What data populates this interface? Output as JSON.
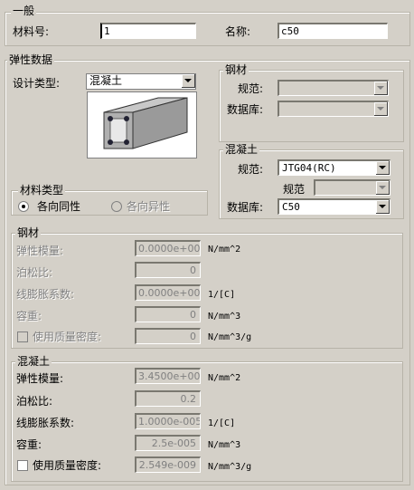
{
  "general": {
    "title": "一般",
    "material_no_label": "材料号:",
    "material_no_value": "1",
    "name_label": "名称:",
    "name_value": "c50"
  },
  "elastic": {
    "title": "弹性数据",
    "design_type_label": "设计类型:",
    "design_type_value": "混凝土",
    "material_type": {
      "title": "材料类型",
      "isotropic_label": "各向同性",
      "anisotropic_label": "各向异性",
      "selected": "isotropic"
    },
    "steel_box": {
      "title": "钢材",
      "spec_label": "规范:",
      "db_label": "数据库:",
      "spec_value": "",
      "db_value": ""
    },
    "concrete_box": {
      "title": "混凝土",
      "spec_label": "规范:",
      "spec_value": "JTG04(RC)",
      "spec2_label": "规范",
      "spec2_value": "",
      "db_label": "数据库:",
      "db_value": "C50"
    }
  },
  "steel_props": {
    "title": "钢材",
    "rows": [
      {
        "label": "弹性模量:",
        "value": "0.0000e+000",
        "unit": "N/mm^2"
      },
      {
        "label": "泊松比:",
        "value": "0",
        "unit": ""
      },
      {
        "label": "线膨胀系数:",
        "value": "0.0000e+000",
        "unit": "1/[C]"
      },
      {
        "label": "容重:",
        "value": "0",
        "unit": "N/mm^3"
      },
      {
        "label": "使用质量密度:",
        "value": "0",
        "unit": "N/mm^3/g"
      }
    ]
  },
  "concrete_props": {
    "title": "混凝土",
    "rows": [
      {
        "label": "弹性模量:",
        "value": "3.4500e+004",
        "unit": "N/mm^2"
      },
      {
        "label": "泊松比:",
        "value": "0.2",
        "unit": ""
      },
      {
        "label": "线膨胀系数:",
        "value": "1.0000e-005",
        "unit": "1/[C]"
      },
      {
        "label": "容重:",
        "value": "2.5e-005",
        "unit": "N/mm^3"
      },
      {
        "label": "使用质量密度:",
        "value": "2.549e-009",
        "unit": "N/mm^3/g"
      }
    ]
  }
}
